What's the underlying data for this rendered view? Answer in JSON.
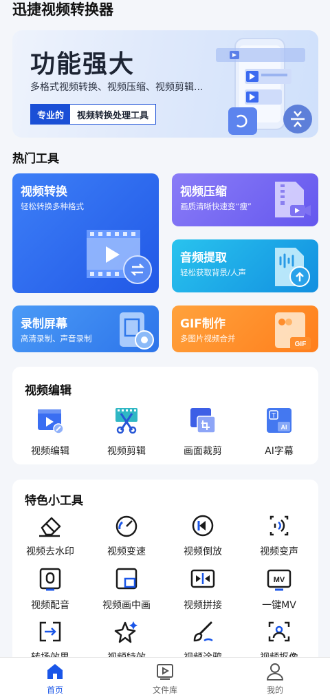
{
  "app": {
    "title": "迅捷视频转换器"
  },
  "banner": {
    "title": "功能强大",
    "subtitle": "多格式视频转换、视频压缩、视频剪辑...",
    "tag_highlight": "专业的",
    "tag_text": "视频转换处理工具"
  },
  "hot_tools": {
    "title": "热门工具",
    "items": [
      {
        "title": "视频转换",
        "subtitle": "轻松转换多种格式"
      },
      {
        "title": "视频压缩",
        "subtitle": "画质清晰快速变“瘦”"
      },
      {
        "title": "音频提取",
        "subtitle": "轻松获取背景/人声"
      },
      {
        "title": "录制屏幕",
        "subtitle": "高清录制、声音录制"
      },
      {
        "title": "GIF制作",
        "subtitle": "多图片视频合并",
        "badge": "GIF"
      }
    ]
  },
  "video_edit": {
    "title": "视频编辑",
    "items": [
      {
        "label": "视频编辑",
        "icon": "video-edit-icon"
      },
      {
        "label": "视频剪辑",
        "icon": "scissors-film-icon"
      },
      {
        "label": "画面裁剪",
        "icon": "crop-icon"
      },
      {
        "label": "AI字幕",
        "icon": "ai-subtitle-icon",
        "badge_t": "T",
        "badge_ai": "AI"
      }
    ]
  },
  "features": {
    "title": "特色小工具",
    "items": [
      {
        "label": "视频去水印",
        "icon": "eraser-icon"
      },
      {
        "label": "视频变速",
        "icon": "speedometer-icon"
      },
      {
        "label": "视频倒放",
        "icon": "rewind-icon"
      },
      {
        "label": "视频变声",
        "icon": "voice-change-icon"
      },
      {
        "label": "视频配音",
        "icon": "dubbing-icon"
      },
      {
        "label": "视频画中画",
        "icon": "pip-icon"
      },
      {
        "label": "视频拼接",
        "icon": "merge-icon"
      },
      {
        "label": "一键MV",
        "icon": "mv-icon",
        "badge": "MV"
      },
      {
        "label": "转场效果",
        "icon": "transition-icon"
      },
      {
        "label": "视频特效",
        "icon": "sparkle-icon"
      },
      {
        "label": "视频涂鸦",
        "icon": "brush-icon"
      },
      {
        "label": "视频抠像",
        "icon": "portrait-icon"
      }
    ]
  },
  "nav": {
    "items": [
      {
        "label": "首页",
        "icon": "home-icon",
        "active": true
      },
      {
        "label": "文件库",
        "icon": "library-icon",
        "active": false
      },
      {
        "label": "我的",
        "icon": "profile-icon",
        "active": false
      }
    ]
  },
  "colors": {
    "accent": "#1a56e8",
    "card_convert": "#2f6bf0",
    "card_compress": "#7a6cf2",
    "card_audio": "#1fb4e6",
    "card_record": "#3f8ef0",
    "card_gif": "#ff8c28"
  }
}
